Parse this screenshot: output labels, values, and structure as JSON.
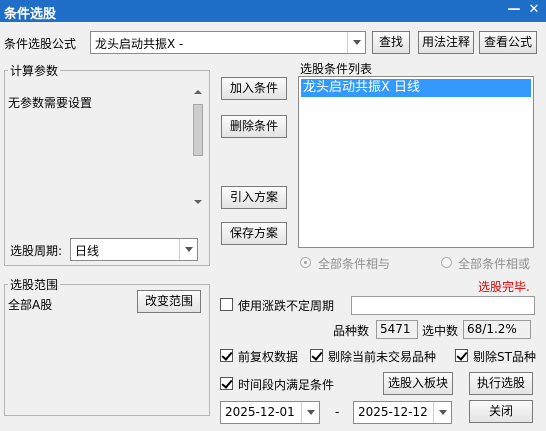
{
  "window": {
    "title": "条件选股",
    "min_glyph": "—",
    "close_glyph": "✕"
  },
  "top": {
    "label": "条件选股公式",
    "formula_value": "龙头启动共振X  -",
    "btn_find": "查找",
    "btn_usage": "用法注释",
    "btn_view": "查看公式"
  },
  "params": {
    "group_label": "计算参数",
    "no_params_text": "无参数需要设置",
    "period_label": "选股周期:",
    "period_value": "日线"
  },
  "actions": {
    "add": "加入条件",
    "delete": "删除条件",
    "import": "引入方案",
    "save": "保存方案"
  },
  "conditions": {
    "label": "选股条件列表",
    "items": [
      "龙头启动共振X  日线"
    ],
    "radio_and": "全部条件相与",
    "radio_or": "全部条件相或",
    "status": "选股完毕."
  },
  "scope": {
    "group_label": "选股范围",
    "value": "全部A股",
    "btn_change": "改变范围"
  },
  "options": {
    "use_unfixed_period": "使用涨跌不定周期",
    "count_label": "品种数",
    "count_value": "5471",
    "selected_label": "选中数",
    "selected_value": "68/1.2%",
    "fq_data": "前复权数据",
    "exclude_untraded": "剔除当前未交易品种",
    "exclude_st": "剔除ST品种",
    "time_range": "时间段内满足条件"
  },
  "bottom": {
    "btn_to_block": "选股入板块",
    "btn_execute": "执行选股",
    "date_from": "2025-12-01",
    "date_sep": "-",
    "date_to": "2025-12-12",
    "btn_close": "关闭"
  },
  "colors": {
    "title_bar": "#1f6fc8",
    "selection": "#3399ff",
    "status": "#e00000"
  }
}
